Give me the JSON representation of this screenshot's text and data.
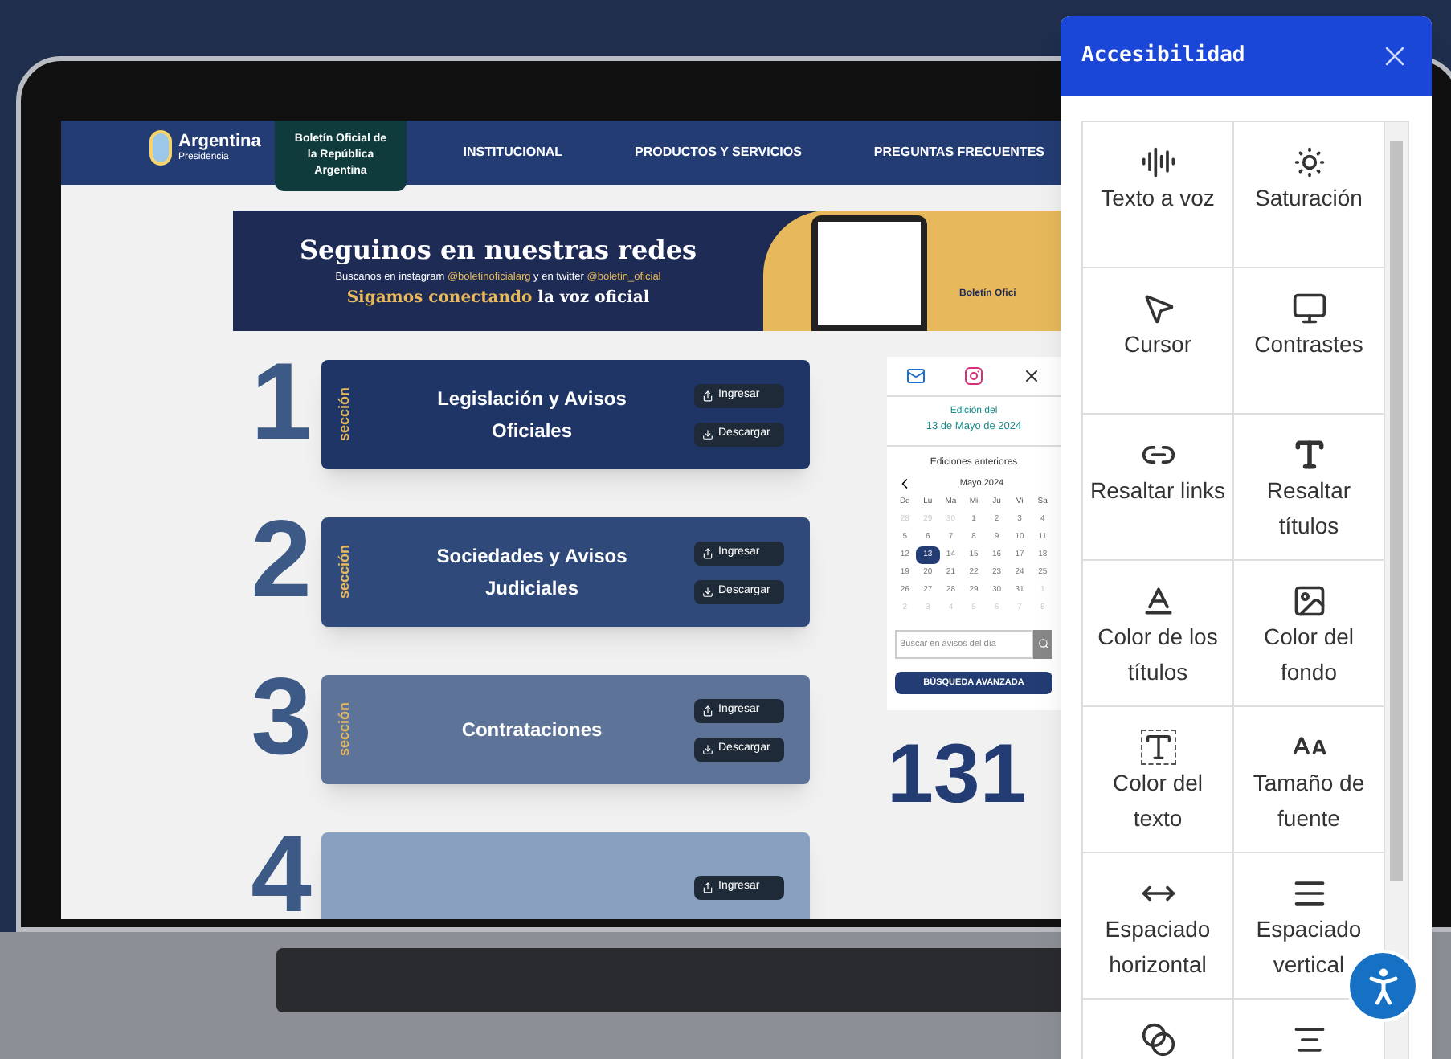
{
  "site": {
    "brand": {
      "name": "Argentina",
      "subtitle": "Presidencia"
    },
    "nav": [
      {
        "label": "Boletín Oficial de la República Argentina",
        "selected": true
      },
      {
        "label": "INSTITUCIONAL",
        "selected": false
      },
      {
        "label": "PRODUCTOS Y SERVICIOS",
        "selected": false
      },
      {
        "label": "PREGUNTAS FRECUENTES",
        "selected": false
      }
    ],
    "banner": {
      "title": "Seguinos en nuestras redes",
      "line_2": [
        {
          "text": "Buscanos en instagram ",
          "highlight": false
        },
        {
          "text": "@boletinoficialarg",
          "highlight": true
        },
        {
          "text": " y en twitter ",
          "highlight": false
        },
        {
          "text": "@boletin_oficial",
          "highlight": true
        }
      ],
      "line_3": [
        {
          "text": "Sigamos conectando",
          "highlight": true
        },
        {
          "text": " la voz oficial",
          "highlight": false
        }
      ],
      "logo_text": "Boletín Ofici"
    },
    "sections": [
      {
        "number": "1",
        "label": "sección",
        "title": "Legislación y Avisos Oficiales",
        "color": "#1f3566",
        "buttons": [
          {
            "label": "Ingresar",
            "kind": "enter"
          },
          {
            "label": "Descargar",
            "kind": "download"
          }
        ]
      },
      {
        "number": "2",
        "label": "sección",
        "title": "Sociedades y Avisos Judiciales",
        "color": "#2f4a7a",
        "buttons": [
          {
            "label": "Ingresar",
            "kind": "enter"
          },
          {
            "label": "Descargar",
            "kind": "download"
          }
        ]
      },
      {
        "number": "3",
        "label": "sección",
        "title": "Contrataciones",
        "color": "#5d7398",
        "buttons": [
          {
            "label": "Ingresar",
            "kind": "enter"
          },
          {
            "label": "Descargar",
            "kind": "download"
          }
        ]
      },
      {
        "number": "4",
        "color": "#8aa0c0",
        "buttons": [
          {
            "label": "Ingresar",
            "kind": "enter"
          }
        ]
      }
    ],
    "sidebar": {
      "edition_label": "Edición del",
      "edition_date": "13 de Mayo de 2024",
      "calendar": {
        "title": "Ediciones anteriores",
        "month": "Mayo 2024",
        "weekdays": [
          "Do",
          "Lu",
          "Ma",
          "Mi",
          "Ju",
          "Vi",
          "Sa"
        ],
        "weeks": [
          [
            {
              "day": "28",
              "muted": true,
              "selected": false
            },
            {
              "day": "29",
              "muted": true,
              "selected": false
            },
            {
              "day": "30",
              "muted": true,
              "selected": false
            },
            {
              "day": "1",
              "muted": false,
              "selected": false
            },
            {
              "day": "2",
              "muted": false,
              "selected": false
            },
            {
              "day": "3",
              "muted": false,
              "selected": false
            },
            {
              "day": "4",
              "muted": false,
              "selected": false
            }
          ],
          [
            {
              "day": "5",
              "muted": false,
              "selected": false
            },
            {
              "day": "6",
              "muted": false,
              "selected": false
            },
            {
              "day": "7",
              "muted": false,
              "selected": false
            },
            {
              "day": "8",
              "muted": false,
              "selected": false
            },
            {
              "day": "9",
              "muted": false,
              "selected": false
            },
            {
              "day": "10",
              "muted": false,
              "selected": false
            },
            {
              "day": "11",
              "muted": false,
              "selected": false
            }
          ],
          [
            {
              "day": "12",
              "muted": false,
              "selected": false
            },
            {
              "day": "13",
              "muted": false,
              "selected": true
            },
            {
              "day": "14",
              "muted": false,
              "selected": false
            },
            {
              "day": "15",
              "muted": false,
              "selected": false
            },
            {
              "day": "16",
              "muted": false,
              "selected": false
            },
            {
              "day": "17",
              "muted": false,
              "selected": false
            },
            {
              "day": "18",
              "muted": false,
              "selected": false
            }
          ],
          [
            {
              "day": "19",
              "muted": false,
              "selected": false
            },
            {
              "day": "20",
              "muted": false,
              "selected": false
            },
            {
              "day": "21",
              "muted": false,
              "selected": false
            },
            {
              "day": "22",
              "muted": false,
              "selected": false
            },
            {
              "day": "23",
              "muted": false,
              "selected": false
            },
            {
              "day": "24",
              "muted": false,
              "selected": false
            },
            {
              "day": "25",
              "muted": false,
              "selected": false
            }
          ],
          [
            {
              "day": "26",
              "muted": false,
              "selected": false
            },
            {
              "day": "27",
              "muted": false,
              "selected": false
            },
            {
              "day": "28",
              "muted": false,
              "selected": false
            },
            {
              "day": "29",
              "muted": false,
              "selected": false
            },
            {
              "day": "30",
              "muted": false,
              "selected": false
            },
            {
              "day": "31",
              "muted": false,
              "selected": false
            },
            {
              "day": "1",
              "muted": true,
              "selected": false
            }
          ],
          [
            {
              "day": "2",
              "muted": true,
              "selected": false
            },
            {
              "day": "3",
              "muted": true,
              "selected": false
            },
            {
              "day": "4",
              "muted": true,
              "selected": false
            },
            {
              "day": "5",
              "muted": true,
              "selected": false
            },
            {
              "day": "6",
              "muted": true,
              "selected": false
            },
            {
              "day": "7",
              "muted": true,
              "selected": false
            },
            {
              "day": "8",
              "muted": true,
              "selected": false
            }
          ]
        ]
      },
      "search": {
        "placeholder": "Buscar en avisos del día"
      },
      "advanced_search": "BÚSQUEDA AVANZADA",
      "counter": "131"
    }
  },
  "panel": {
    "title": "Accesibilidad",
    "items": [
      {
        "label": "Texto a voz",
        "kind": "audio"
      },
      {
        "label": "Saturación",
        "kind": "saturation"
      },
      {
        "label": "Cursor",
        "kind": "cursor"
      },
      {
        "label": "Contrastes",
        "kind": "contrast"
      },
      {
        "label": "Resaltar links",
        "kind": "links"
      },
      {
        "label": "Resaltar títulos",
        "kind": "titles"
      },
      {
        "label": "Color de los títulos",
        "kind": "title-color"
      },
      {
        "label": "Color del fondo",
        "kind": "background-color"
      },
      {
        "label": "Color del texto",
        "kind": "text-color"
      },
      {
        "label": "Tamaño de fuente",
        "kind": "font-size"
      },
      {
        "label": "Espaciado horizontal",
        "kind": "h-spacing"
      },
      {
        "label": "Espaciado vertical",
        "kind": "v-spacing"
      },
      {
        "kind": "color-filter"
      },
      {
        "kind": "align"
      }
    ]
  }
}
